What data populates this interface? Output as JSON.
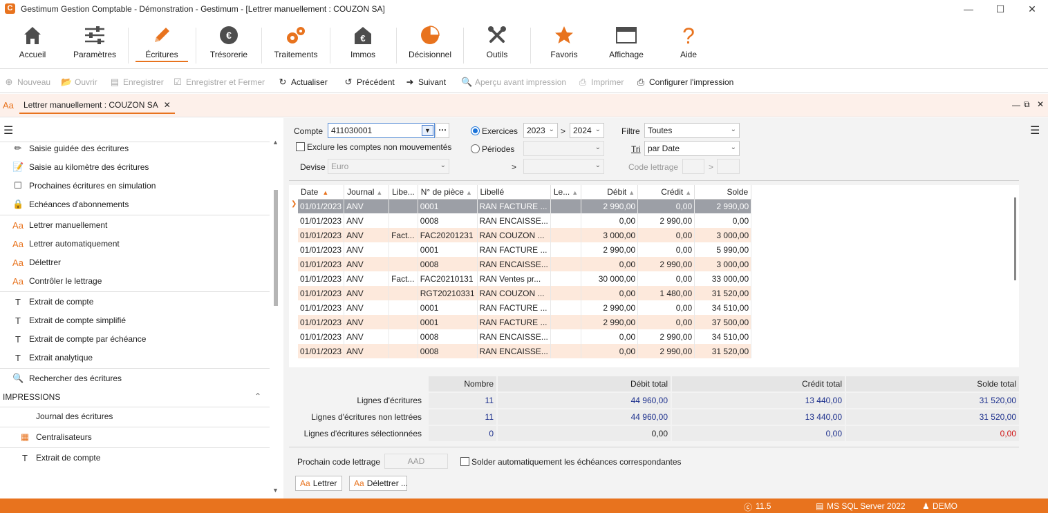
{
  "window": {
    "title": "Gestimum Gestion Comptable - Démonstration - Gestimum - [Lettrer manuellement : COUZON SA]",
    "app_icon": "C"
  },
  "ribbon": {
    "items": [
      {
        "label": "Accueil",
        "icon": "house-icon"
      },
      {
        "label": "Paramètres",
        "icon": "sliders-icon"
      },
      {
        "label": "Écritures",
        "icon": "pencil-icon"
      },
      {
        "label": "Trésorerie",
        "icon": "euro-coin-icon"
      },
      {
        "label": "Traitements",
        "icon": "gears-icon"
      },
      {
        "label": "Immos",
        "icon": "euro-house-icon"
      },
      {
        "label": "Décisionnel",
        "icon": "pie-chart-icon"
      },
      {
        "label": "Outils",
        "icon": "tools-icon"
      },
      {
        "label": "Favoris",
        "icon": "star-icon"
      },
      {
        "label": "Affichage",
        "icon": "window-icon"
      },
      {
        "label": "Aide",
        "icon": "question-icon"
      }
    ],
    "active": "Écritures",
    "accent": "#e8731e"
  },
  "toolbar": {
    "nouveau": "Nouveau",
    "ouvrir": "Ouvrir",
    "enregistrer": "Enregistrer",
    "enregistrer_fermer": "Enregistrer et Fermer",
    "actualiser": "Actualiser",
    "precedent": "Précédent",
    "suivant": "Suivant",
    "apercu": "Aperçu avant impression",
    "imprimer": "Imprimer",
    "configurer": "Configurer l'impression"
  },
  "doc_tab": {
    "label": "Lettrer manuellement : COUZON SA",
    "icon_text": "Aa"
  },
  "left_menu": {
    "items": [
      "Saisie guidée des écritures",
      "Saisie au kilomètre des écritures",
      "Prochaines écritures en simulation",
      "Echéances d'abonnements",
      "Lettrer manuellement",
      "Lettrer automatiquement",
      "Délettrer",
      "Contrôler le lettrage",
      "Extrait de compte",
      "Extrait de compte simplifié",
      "Extrait de compte par échéance",
      "Extrait analytique",
      "Rechercher des écritures"
    ],
    "section_impressions": "IMPRESSIONS",
    "impressions": [
      "Journal des écritures",
      "Centralisateurs",
      "Extrait de compte"
    ]
  },
  "form": {
    "compte_label": "Compte",
    "compte_value": "411030001",
    "exclure_label": "Exclure les comptes non mouvementés",
    "devise_label": "Devise",
    "devise_value": "Euro",
    "exercices_label": "Exercices",
    "exercice_from": "2023",
    "exercice_to": "2024",
    "periodes_label": "Périodes",
    "gt": ">",
    "filtre_label": "Filtre",
    "filtre_value": "Toutes",
    "tri_label": "Tri",
    "tri_value": "par Date",
    "code_lettrage_label": "Code lettrage"
  },
  "grid": {
    "columns": [
      "Date",
      "Journal",
      "Libe...",
      "N° de pièce",
      "Libellé",
      "Le...",
      "Débit",
      "Crédit",
      "Solde"
    ],
    "rows": [
      [
        "01/01/2023",
        "ANV",
        "",
        "0001",
        "RAN FACTURE ...",
        "",
        "2 990,00",
        "0,00",
        "2 990,00"
      ],
      [
        "01/01/2023",
        "ANV",
        "",
        "0008",
        "RAN ENCAISSE...",
        "",
        "0,00",
        "2 990,00",
        "0,00"
      ],
      [
        "01/01/2023",
        "ANV",
        "Fact...",
        "FAC20201231",
        "RAN COUZON ...",
        "",
        "3 000,00",
        "0,00",
        "3 000,00"
      ],
      [
        "01/01/2023",
        "ANV",
        "",
        "0001",
        "RAN FACTURE ...",
        "",
        "2 990,00",
        "0,00",
        "5 990,00"
      ],
      [
        "01/01/2023",
        "ANV",
        "",
        "0008",
        "RAN ENCAISSE...",
        "",
        "0,00",
        "2 990,00",
        "3 000,00"
      ],
      [
        "01/01/2023",
        "ANV",
        "Fact...",
        "FAC20210131",
        "RAN Ventes pr...",
        "",
        "30 000,00",
        "0,00",
        "33 000,00"
      ],
      [
        "01/01/2023",
        "ANV",
        "",
        "RGT20210331",
        "RAN COUZON ...",
        "",
        "0,00",
        "1 480,00",
        "31 520,00"
      ],
      [
        "01/01/2023",
        "ANV",
        "",
        "0001",
        "RAN FACTURE ...",
        "",
        "2 990,00",
        "0,00",
        "34 510,00"
      ],
      [
        "01/01/2023",
        "ANV",
        "",
        "0001",
        "RAN FACTURE ...",
        "",
        "2 990,00",
        "0,00",
        "37 500,00"
      ],
      [
        "01/01/2023",
        "ANV",
        "",
        "0008",
        "RAN ENCAISSE...",
        "",
        "0,00",
        "2 990,00",
        "34 510,00"
      ],
      [
        "01/01/2023",
        "ANV",
        "",
        "0008",
        "RAN ENCAISSE...",
        "",
        "0,00",
        "2 990,00",
        "31 520,00"
      ]
    ]
  },
  "summary": {
    "headers": [
      "Nombre",
      "Débit total",
      "Crédit total",
      "Solde total"
    ],
    "rows": [
      {
        "label": "Lignes d'écritures",
        "values": [
          "11",
          "44 960,00",
          "13 440,00",
          "31 520,00"
        ]
      },
      {
        "label": "Lignes d'écritures non lettrées",
        "values": [
          "11",
          "44 960,00",
          "13 440,00",
          "31 520,00"
        ]
      },
      {
        "label": "Lignes d'écritures sélectionnées",
        "values": [
          "0",
          "0,00",
          "0,00",
          "0,00"
        ]
      }
    ]
  },
  "bottom": {
    "prochain_label": "Prochain code lettrage",
    "prochain_value": "AAD",
    "solder_label": "Solder automatiquement les échéances correspondantes",
    "lettrer": "Lettrer",
    "delettrer": "Délettrer ..."
  },
  "status": {
    "version": "11.5",
    "db": "MS SQL Server 2022",
    "user": "DEMO"
  }
}
